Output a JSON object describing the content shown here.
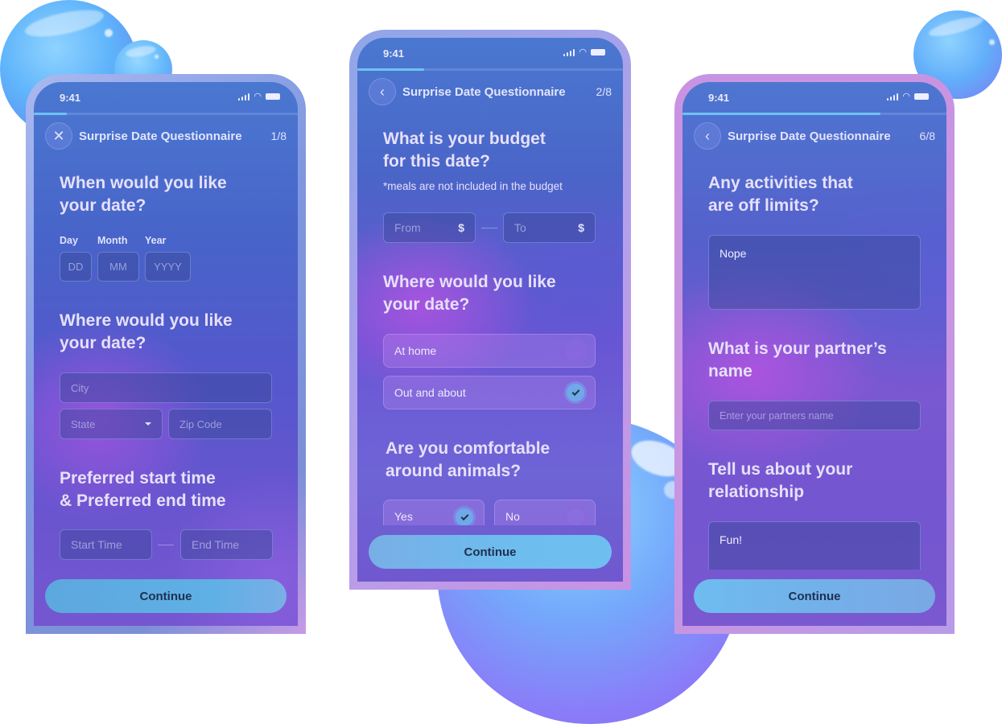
{
  "colors": {
    "progress_fill": "#6ec2f2",
    "continue_button": "#5fb0e6",
    "radio_checked": "#6fa9ec"
  },
  "screens": [
    {
      "status_time": "9:41",
      "progress_percent": 12.5,
      "header": {
        "nav_icon": "close-icon",
        "title": "Surprise Date Questionnaire",
        "step": "1/8"
      },
      "q1": {
        "title_line1": "When would you like",
        "title_line2": "your date?",
        "labels": [
          "Day",
          "Month",
          "Year"
        ],
        "placeholders": [
          "DD",
          "MM",
          "YYYY"
        ]
      },
      "q2": {
        "title_line1": "Where would you like",
        "title_line2": "your date?",
        "city_placeholder": "City",
        "state_placeholder": "State",
        "zip_placeholder": "Zip Code"
      },
      "q3": {
        "title_line1": "Preferred start time",
        "title_line2": "& Preferred end time",
        "start_placeholder": "Start Time",
        "end_placeholder": "End Time"
      },
      "continue_label": "Continue"
    },
    {
      "status_time": "9:41",
      "progress_percent": 25,
      "header": {
        "nav_icon": "chevron-left-icon",
        "title": "Surprise Date Questionnaire",
        "step": "2/8"
      },
      "q1": {
        "title_line1": "What is your budget",
        "title_line2": "for this date?",
        "note": "*meals are not included in the budget",
        "from_placeholder": "From",
        "to_placeholder": "To",
        "currency": "$"
      },
      "q2": {
        "title_line1": "Where would you like",
        "title_line2": "your date?",
        "options": [
          {
            "label": "At home",
            "selected": false
          },
          {
            "label": "Out and about",
            "selected": true
          }
        ]
      },
      "q3": {
        "title_line1": "Are you comfortable",
        "title_line2": "around animals?",
        "options": [
          {
            "label": "Yes",
            "selected": true
          },
          {
            "label": "No",
            "selected": false
          }
        ]
      },
      "continue_label": "Continue"
    },
    {
      "status_time": "9:41",
      "progress_percent": 75,
      "header": {
        "nav_icon": "chevron-left-icon",
        "title": "Surprise Date Questionnaire",
        "step": "6/8"
      },
      "q1": {
        "title_line1": "Any activities that",
        "title_line2": "are off limits?",
        "value": "Nope"
      },
      "q2": {
        "title_line1": "What is your partner’s",
        "title_line2": "name",
        "placeholder": "Enter your partners name"
      },
      "q3": {
        "title_line1": "Tell us about your",
        "title_line2": "relationship",
        "value": "Fun!"
      },
      "continue_label": "Continue"
    }
  ]
}
